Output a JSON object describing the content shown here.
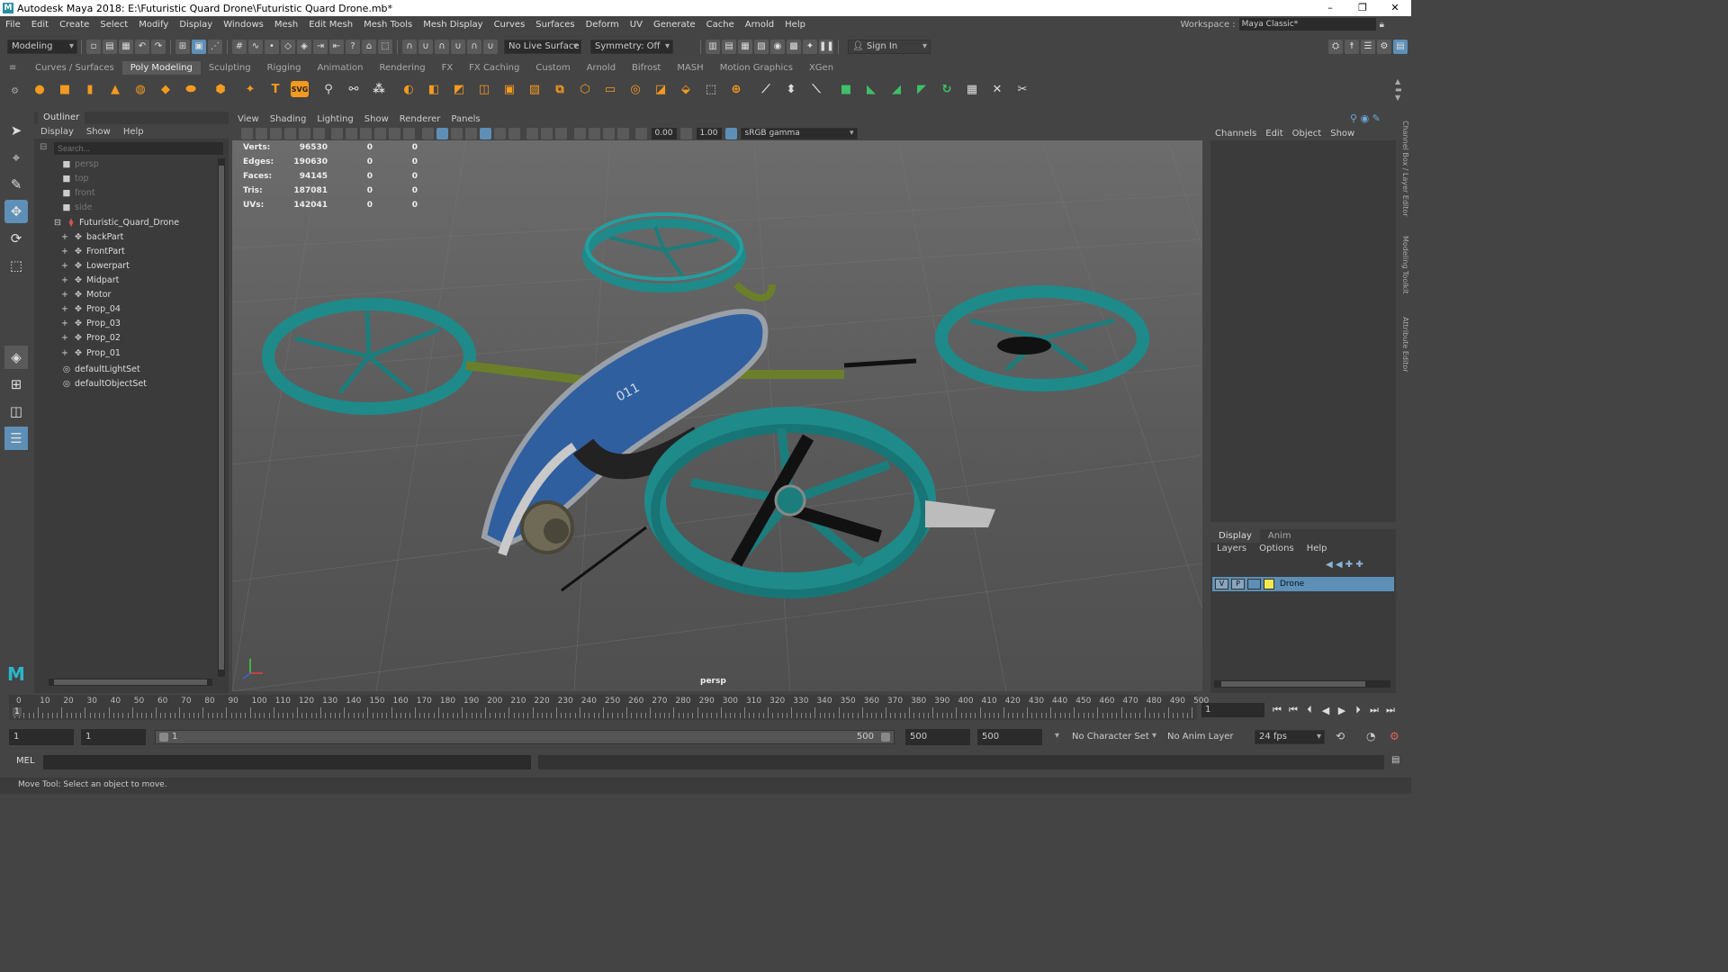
{
  "titlebar": {
    "title": "Autodesk Maya 2018: E:\\Futuristic Quard Drone\\Futuristic Quard Drone.mb*",
    "minimize": "–",
    "maximize": "❐",
    "close": "✕"
  },
  "menubar": {
    "items": [
      "File",
      "Edit",
      "Create",
      "Select",
      "Modify",
      "Display",
      "Windows",
      "Mesh",
      "Edit Mesh",
      "Mesh Tools",
      "Mesh Display",
      "Curves",
      "Surfaces",
      "Deform",
      "UV",
      "Generate",
      "Cache",
      "Arnold",
      "Help"
    ],
    "workspace_label": "Workspace :",
    "workspace_value": "Maya Classic*"
  },
  "statusline": {
    "mode": "Modeling",
    "live_surface": "No Live Surface",
    "symmetry": "Symmetry: Off",
    "sign_in": "Sign In"
  },
  "shelf": {
    "tabs": [
      "Curves / Surfaces",
      "Poly Modeling",
      "Sculpting",
      "Rigging",
      "Animation",
      "Rendering",
      "FX",
      "FX Caching",
      "Custom",
      "Arnold",
      "Bifrost",
      "MASH",
      "Motion Graphics",
      "XGen"
    ],
    "active_tab": "Poly Modeling",
    "svg_label": "SVG",
    "text_label": "T"
  },
  "outliner": {
    "title": "Outliner",
    "menu": [
      "Display",
      "Show",
      "Help"
    ],
    "search_placeholder": "Search...",
    "cameras": [
      "persp",
      "top",
      "front",
      "side"
    ],
    "root": "Futuristic_Quard_Drone",
    "children": [
      "backPart",
      "FrontPart",
      "Lowerpart",
      "Midpart",
      "Motor",
      "Prop_04",
      "Prop_03",
      "Prop_02",
      "Prop_01"
    ],
    "sets": [
      "defaultLightSet",
      "defaultObjectSet"
    ]
  },
  "viewport": {
    "menu": [
      "View",
      "Shading",
      "Lighting",
      "Show",
      "Renderer",
      "Panels"
    ],
    "exposure": "0.00",
    "gamma": "1.00",
    "color_space": "sRGB gamma",
    "hud": [
      {
        "label": "Verts:",
        "value": "96530",
        "sel": "0",
        "comp": "0"
      },
      {
        "label": "Edges:",
        "value": "190630",
        "sel": "0",
        "comp": "0"
      },
      {
        "label": "Faces:",
        "value": "94145",
        "sel": "0",
        "comp": "0"
      },
      {
        "label": "Tris:",
        "value": "187081",
        "sel": "0",
        "comp": "0"
      },
      {
        "label": "UVs:",
        "value": "142041",
        "sel": "0",
        "comp": "0"
      }
    ],
    "camera_label": "persp",
    "drone_number": "011"
  },
  "channelbox": {
    "menu": [
      "Channels",
      "Edit",
      "Object",
      "Show"
    ],
    "side_tabs": [
      "Channel Box / Layer Editor",
      "Modeling Toolkit",
      "Attribute Editor"
    ]
  },
  "layers": {
    "tabs": [
      "Display",
      "Anim"
    ],
    "active_tab": "Display",
    "menu": [
      "Layers",
      "Options",
      "Help"
    ],
    "layer_name": "Drone",
    "v_flag": "V",
    "p_flag": "P",
    "layer_color": "#f2e94e"
  },
  "timeline": {
    "ticks": [
      "0",
      "10",
      "20",
      "30",
      "40",
      "50",
      "60",
      "70",
      "80",
      "90",
      "100",
      "110",
      "120",
      "130",
      "140",
      "150",
      "160",
      "170",
      "180",
      "190",
      "200",
      "210",
      "220",
      "230",
      "240",
      "250",
      "260",
      "270",
      "280",
      "290",
      "300",
      "310",
      "320",
      "330",
      "340",
      "350",
      "360",
      "370",
      "380",
      "390",
      "400",
      "410",
      "420",
      "430",
      "440",
      "450",
      "460",
      "470",
      "480",
      "490",
      "500"
    ],
    "current_marker": "1",
    "current_frame": "1"
  },
  "range": {
    "start": "1",
    "playback_start": "1",
    "slider_start": "1",
    "slider_end": "500",
    "playback_end": "500",
    "end": "500",
    "character_set": "No Character Set",
    "anim_layer": "No Anim Layer",
    "fps": "24 fps"
  },
  "cmdline": {
    "label": "MEL"
  },
  "helpline": {
    "text": "Move Tool: Select an object to move."
  },
  "colors": {
    "accent": "#5d8fb7",
    "shelf_orange": "#f49a20",
    "drone_teal": "#1f8a8a",
    "drone_blue": "#2f5f9f"
  }
}
